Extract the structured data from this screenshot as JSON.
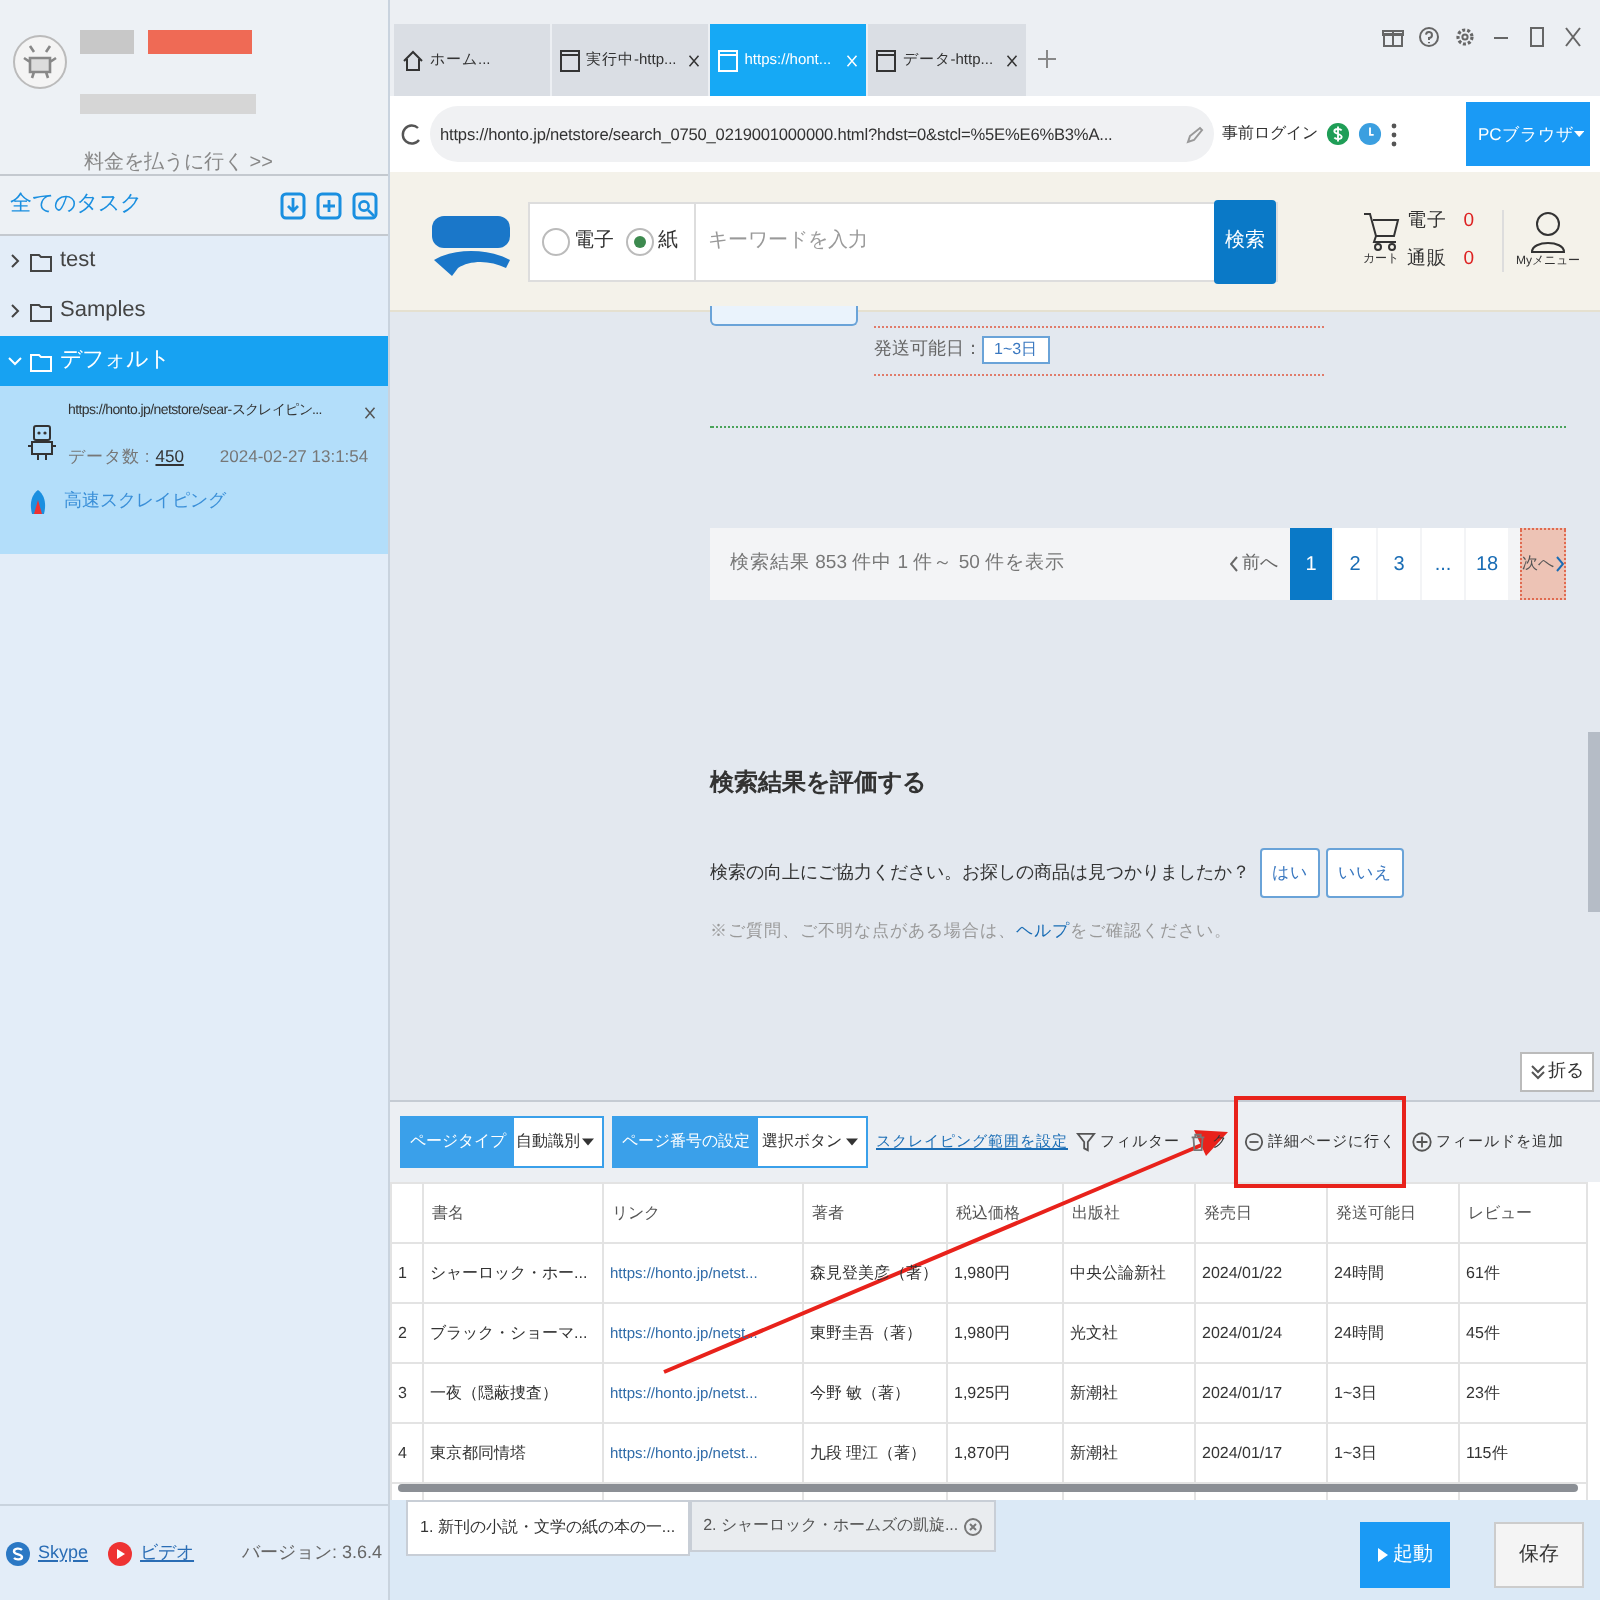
{
  "sidebar": {
    "pay_link": "料金を払うに行く >>",
    "tasks_title": "全てのタスク",
    "folders": [
      {
        "name": "test",
        "expanded": false,
        "selected": false
      },
      {
        "name": "Samples",
        "expanded": false,
        "selected": false
      },
      {
        "name": "デフォルト",
        "expanded": true,
        "selected": true
      }
    ],
    "task": {
      "title": "https://honto.jp/netstore/sear-スクレイピン...",
      "count_label": "データ数 :",
      "count": "450",
      "date": "2024-02-27 13:1:54",
      "mode": "高速スクレイピング"
    },
    "footer": {
      "links": [
        {
          "kind": "skype",
          "label": "Skype"
        },
        {
          "kind": "video",
          "label": "ビデオ"
        }
      ],
      "version": "バージョン: 3.6.4"
    }
  },
  "tabs": [
    {
      "kind": "home",
      "label": "ホーム...",
      "selected": false,
      "closable": false
    },
    {
      "kind": "page",
      "label": "実行中-http...",
      "selected": false,
      "closable": true
    },
    {
      "kind": "page",
      "label": "https://hont...",
      "selected": true,
      "closable": true
    },
    {
      "kind": "page",
      "label": "データ-http...",
      "selected": false,
      "closable": true
    }
  ],
  "address": {
    "url": "https://honto.jp/netstore/search_0750_0219001000000.html?hdst=0&stcl=%5E%E6%B3%A...",
    "prelogin": "事前ログイン",
    "browser_mode": "PCブラウザ"
  },
  "honto": {
    "radios": [
      {
        "label": "電子",
        "selected": false
      },
      {
        "label": "紙",
        "selected": true
      }
    ],
    "search_placeholder": "キーワードを入力",
    "search_button": "検索",
    "cart": [
      {
        "label": "電子",
        "count": "0"
      },
      {
        "label": "通販",
        "count": "0"
      }
    ],
    "cart_label": "カート",
    "menu_label": "Myメニュー"
  },
  "page": {
    "ship_label": "発送可能日：",
    "ship_value": "1~3日",
    "result_text": "検索結果 853 件中 1 件～ 50 件を表示",
    "pagination": {
      "prev": "前へ",
      "pages": [
        {
          "label": "1",
          "selected": true
        },
        {
          "label": "2",
          "selected": false
        },
        {
          "label": "3",
          "selected": false
        },
        {
          "label": "...",
          "selected": false
        },
        {
          "label": "18",
          "selected": false
        }
      ],
      "next": "次へ"
    },
    "evaluate_title": "検索結果を評価する",
    "question": "検索の向上にご協力ください。お探しの商品は見つかりましたか？",
    "answers": [
      "はい",
      "いいえ"
    ],
    "note_before": "※ご質問、ご不明な点がある場合は、",
    "note_link": "ヘルプ",
    "note_after": "をご確認ください。"
  },
  "collapse_button": "折る",
  "panel": {
    "selects": [
      {
        "label": "ページタイプ",
        "value": "自動識別"
      },
      {
        "label": "ページ番号の設定",
        "value": "選択ボタン"
      }
    ],
    "range_link": "スクレイピング範囲を設定",
    "actions": [
      {
        "kind": "filter",
        "label": "フィルター",
        "highlighted": false
      },
      {
        "kind": "clear",
        "label": "ク",
        "highlighted": false
      },
      {
        "kind": "detail",
        "label": "詳細ページに行く",
        "highlighted": true
      },
      {
        "kind": "add",
        "label": "フィールドを追加",
        "highlighted": false
      }
    ],
    "columns": [
      "",
      "書名",
      "リンク",
      "著者",
      "税込価格",
      "出版社",
      "発売日",
      "発送可能日",
      "レビュー"
    ],
    "rows": [
      [
        "1",
        "シャーロック・ホー...",
        "https://honto.jp/netst...",
        "森見登美彦（著）",
        "1,980円",
        "中央公論新社",
        "2024/01/22",
        "24時間",
        "61件"
      ],
      [
        "2",
        "ブラック・ショーマ...",
        "https://honto.jp/netst...",
        "東野圭吾（著）",
        "1,980円",
        "光文社",
        "2024/01/24",
        "24時間",
        "45件"
      ],
      [
        "3",
        "一夜（隠蔽捜査）",
        "https://honto.jp/netst...",
        "今野 敏（著）",
        "1,925円",
        "新潮社",
        "2024/01/17",
        "1~3日",
        "23件"
      ],
      [
        "4",
        "東京都同情塔",
        "https://honto.jp/netst...",
        "九段 理江（著）",
        "1,870円",
        "新潮社",
        "2024/01/17",
        "1~3日",
        "115件"
      ]
    ]
  },
  "bottom_tabs": [
    {
      "label": "1. 新刊の小説・文学の紙の本の一...",
      "selected": true,
      "closable": false
    },
    {
      "label": "2. シャーロック・ホームズの凱旋...",
      "selected": false,
      "closable": true
    }
  ],
  "start_button": "起動",
  "save_button": "保存"
}
